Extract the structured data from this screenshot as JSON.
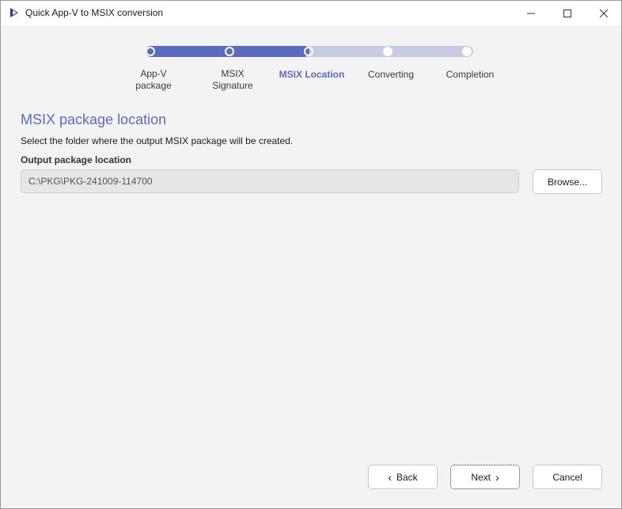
{
  "window": {
    "title": "Quick App-V to MSIX conversion",
    "icons": [
      "app-icon",
      "minimize-icon",
      "maximize-icon",
      "close-icon"
    ]
  },
  "stepper": {
    "progress": 0.5,
    "current_step": 3,
    "steps": [
      {
        "label_line1": "App-V",
        "label_line2": "package",
        "state": "done"
      },
      {
        "label_line1": "MSIX",
        "label_line2": "Signature",
        "state": "done"
      },
      {
        "label_line1": "MSIX Location",
        "label_line2": "",
        "state": "active"
      },
      {
        "label_line1": "Converting",
        "label_line2": "",
        "state": "pending"
      },
      {
        "label_line1": "Completion",
        "label_line2": "",
        "state": "pending"
      }
    ]
  },
  "main": {
    "heading": "MSIX package location",
    "description": "Select the folder where the output MSIX package will be created.",
    "field_label": "Output package location",
    "field_value": "C:\\PKG\\PKG-241009-114700",
    "browse_label": "Browse..."
  },
  "footer": {
    "back_label": "Back",
    "next_label": "Next",
    "cancel_label": "Cancel"
  },
  "colors": {
    "accent": "#5b6bc0",
    "track": "#c9cbe3"
  }
}
